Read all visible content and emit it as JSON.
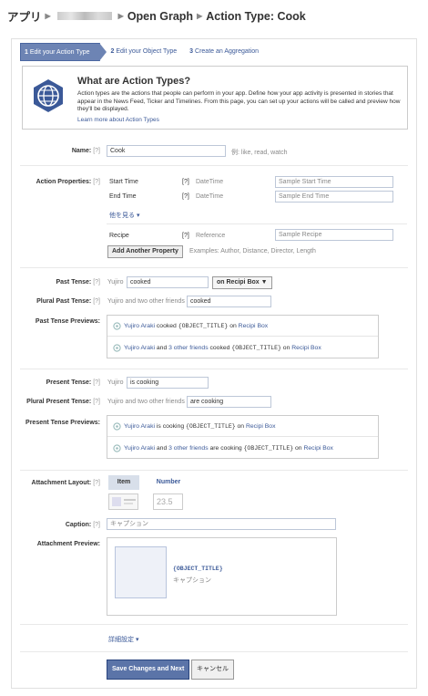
{
  "breadcrumb": {
    "app": "アプリ",
    "graph": "Open Graph",
    "title": "Action Type: Cook"
  },
  "steps": [
    {
      "num": "1",
      "label": "Edit your Action Type"
    },
    {
      "num": "2",
      "label": "Edit your Object Type"
    },
    {
      "num": "3",
      "label": "Create an Aggregation"
    }
  ],
  "info": {
    "title": "What are Action Types?",
    "description": "Action types are the actions that people can perform in your app. Define how your app activity is presented in stories that appear in the News Feed, Ticker and Timelines. From this page, you can set up your actions will be called and preview how they'll be displayed.",
    "link": "Learn more about Action Types"
  },
  "help": "[?]",
  "name": {
    "label": "Name:",
    "value": "Cook",
    "hint": "例: like, read, watch"
  },
  "props": {
    "label": "Action Properties:",
    "items": [
      {
        "name": "Start Time",
        "type": "DateTime",
        "placeholder": "Sample Start Time"
      },
      {
        "name": "End Time",
        "type": "DateTime",
        "placeholder": "Sample End Time"
      }
    ],
    "more": "他を見る",
    "recipe": {
      "name": "Recipe",
      "type": "Reference",
      "placeholder": "Sample Recipe"
    },
    "add_button": "Add Another Property",
    "examples": "Examples: Author, Distance, Director, Length"
  },
  "past": {
    "label": "Past Tense:",
    "subject": "Yujiro",
    "value": "cooked",
    "dropdown": "on Recipi Box ▼",
    "plural_label": "Plural Past Tense:",
    "plural_subject": "Yujiro and two other friends",
    "plural_value": "cooked",
    "previews_label": "Past Tense Previews:"
  },
  "present": {
    "label": "Present Tense:",
    "subject": "Yujiro",
    "value": "is cooking",
    "plural_label": "Plural Present Tense:",
    "plural_subject": "Yujiro and two other friends",
    "plural_value": "are cooking",
    "previews_label": "Present Tense Previews:"
  },
  "previews": {
    "actor": "Yujiro Araki",
    "and": "and",
    "others": "3 other friends",
    "object": "{OBJECT_TITLE}",
    "on": "on",
    "app": "Recipi Box",
    "past_single": "cooked",
    "past_plural": "cooked",
    "present_single": "is cooking",
    "present_plural": "are cooking"
  },
  "attachment": {
    "label": "Attachment Layout:",
    "item_tab": "Item",
    "number_tab": "Number",
    "number_sample": "23.5",
    "caption_label": "Caption:",
    "caption_placeholder": "キャプション",
    "preview_label": "Attachment Preview:",
    "preview_title": "{OBJECT_TITLE}",
    "preview_caption": "キャプション"
  },
  "advanced": "詳細設定",
  "actions": {
    "save": "Save Changes and Next",
    "cancel": "キャンセル"
  }
}
